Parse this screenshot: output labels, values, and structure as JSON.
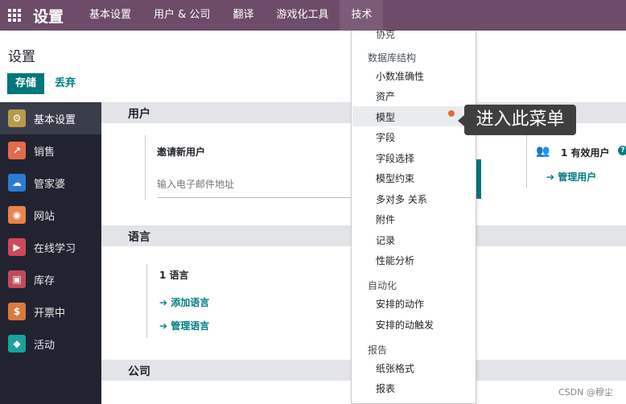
{
  "navbar": {
    "brand": "设置",
    "menu": [
      "基本设置",
      "用户 & 公司",
      "翻译",
      "游戏化工具",
      "技术"
    ]
  },
  "control_panel": {
    "title": "设置",
    "save_label": "存储",
    "discard_label": "丢弃"
  },
  "sidebar": {
    "items": [
      {
        "label": "基本设置",
        "icon": "gear-icon",
        "color": "#b79a4a"
      },
      {
        "label": "销售",
        "icon": "chart-icon",
        "color": "#e66a4a"
      },
      {
        "label": "管家婆",
        "icon": "cloud-icon",
        "color": "#2b7bd6"
      },
      {
        "label": "网站",
        "icon": "globe-icon",
        "color": "#e8834a"
      },
      {
        "label": "在线学习",
        "icon": "slides-icon",
        "color": "#d0485b"
      },
      {
        "label": "库存",
        "icon": "box-icon",
        "color": "#c04b5e"
      },
      {
        "label": "开票中",
        "icon": "invoice-icon",
        "color": "#d97a3a"
      },
      {
        "label": "活动",
        "icon": "ticket-icon",
        "color": "#1aa39a"
      }
    ]
  },
  "sections": {
    "users": {
      "title": "用户",
      "invite_label": "邀请新用户",
      "email_placeholder": "输入电子邮件地址",
      "active_users": "1 有效用户",
      "manage_users": "管理用户"
    },
    "language": {
      "title": "语言",
      "count": "1 语言",
      "add_language": "添加语言",
      "manage_languages": "管理语言"
    },
    "company": {
      "title": "公司"
    }
  },
  "dropdown": {
    "cut_item": "协克",
    "groups": [
      {
        "header": "数据库结构",
        "items": [
          "小数准确性",
          "资产",
          "模型",
          "字段",
          "字段选择",
          "模型约束",
          "多对多 关系",
          "附件",
          "记录",
          "性能分析"
        ]
      },
      {
        "header": "自动化",
        "items": [
          "安排的动作",
          "安排的动触发"
        ]
      },
      {
        "header": "报告",
        "items": [
          "纸张格式",
          "报表"
        ]
      }
    ]
  },
  "tooltip": {
    "text": "进入此菜单"
  },
  "watermark": "CSDN @穆尘",
  "colors": {
    "navbar": "#6d4c6a",
    "accent": "#00777a",
    "link": "#017e84",
    "sidebar": "#212430"
  }
}
